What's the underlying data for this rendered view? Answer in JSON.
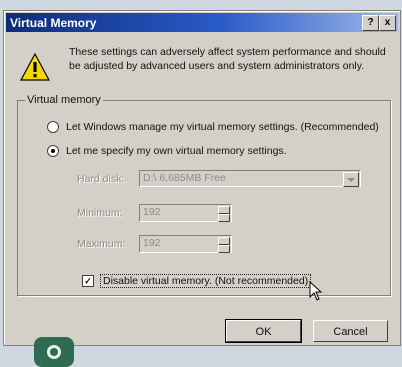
{
  "window": {
    "title": "Virtual Memory",
    "help_label": "?",
    "close_label": "x"
  },
  "warning": {
    "icon": "warning-icon",
    "text": "These settings can adversely affect system performance and should be adjusted by advanced users and system administrators only."
  },
  "virtual_memory": {
    "group_label": "Virtual memory",
    "option_windows": "Let Windows manage my virtual memory settings. (Recommended)",
    "option_manual": "Let me specify my own virtual memory settings.",
    "selected_option": "manual",
    "hard_disk_label": "Hard disk:",
    "hard_disk_value": "D:\\ 6,685MB Free",
    "minimum_label": "Minimum:",
    "minimum_value": "192",
    "maximum_label": "Maximum:",
    "maximum_value": "192",
    "disable_label": "Disable virtual memory. (Not recommended)",
    "disable_checked": true,
    "check_mark": "✓"
  },
  "buttons": {
    "ok_label": "OK",
    "cancel_label": "Cancel"
  }
}
